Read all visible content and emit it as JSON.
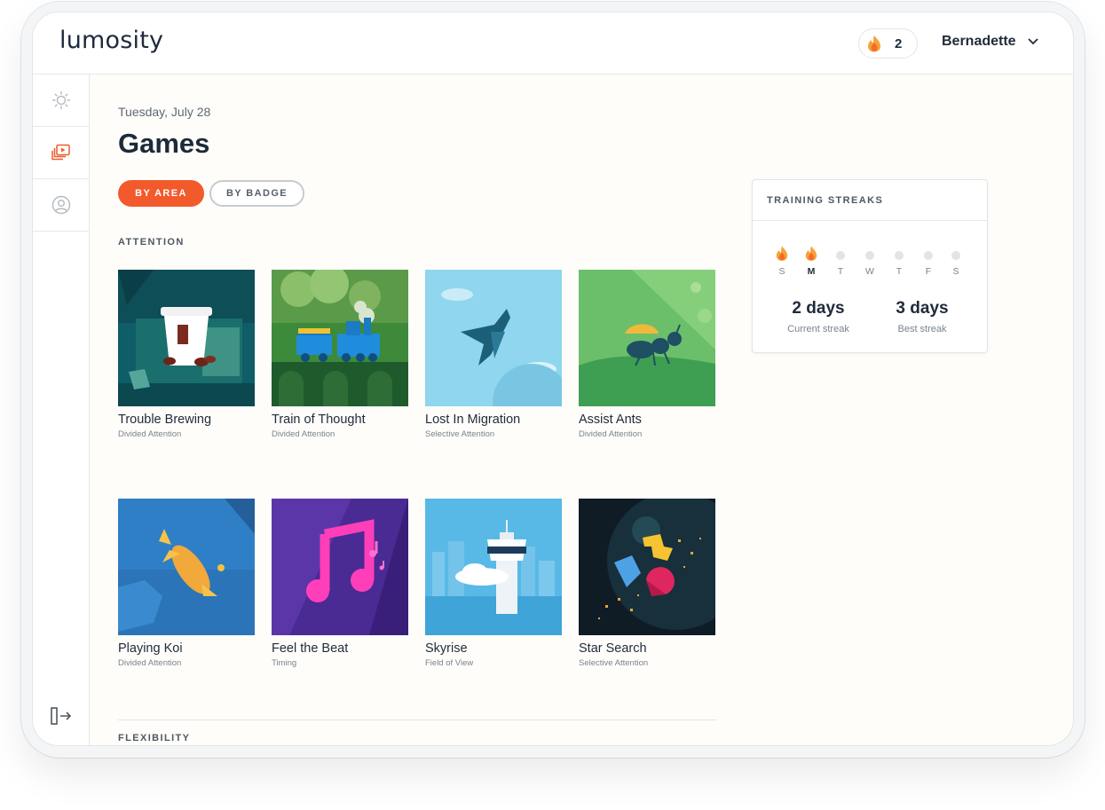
{
  "app": {
    "logo": "lumosity"
  },
  "header": {
    "streak_count": "2",
    "user_name": "Bernadette"
  },
  "sidebar": {
    "items": [
      {
        "icon": "sun-icon",
        "active": false
      },
      {
        "icon": "games-icon",
        "active": true
      },
      {
        "icon": "profile-icon",
        "active": false
      }
    ],
    "logout_icon": "logout-icon"
  },
  "page": {
    "date": "Tuesday, July 28",
    "title": "Games"
  },
  "filters": {
    "by_area": "BY AREA",
    "by_badge": "BY BADGE"
  },
  "sections": [
    {
      "label": "ATTENTION",
      "games": [
        {
          "name": "Trouble Brewing",
          "area": "Divided Attention"
        },
        {
          "name": "Train of Thought",
          "area": "Divided Attention"
        },
        {
          "name": "Lost In Migration",
          "area": "Selective Attention"
        },
        {
          "name": "Assist Ants",
          "area": "Divided Attention"
        },
        {
          "name": "Playing Koi",
          "area": "Divided Attention"
        },
        {
          "name": "Feel the Beat",
          "area": "Timing"
        },
        {
          "name": "Skyrise",
          "area": "Field of View"
        },
        {
          "name": "Star Search",
          "area": "Selective Attention"
        }
      ]
    },
    {
      "label": "FLEXIBILITY",
      "games": []
    }
  ],
  "streaks": {
    "title": "TRAINING STREAKS",
    "days": [
      {
        "letter": "S",
        "trained": true,
        "today": false
      },
      {
        "letter": "M",
        "trained": true,
        "today": true
      },
      {
        "letter": "T",
        "trained": false,
        "today": false
      },
      {
        "letter": "W",
        "trained": false,
        "today": false
      },
      {
        "letter": "T",
        "trained": false,
        "today": false
      },
      {
        "letter": "F",
        "trained": false,
        "today": false
      },
      {
        "letter": "S",
        "trained": false,
        "today": false
      }
    ],
    "current_value": "2 days",
    "current_label": "Current streak",
    "best_value": "3 days",
    "best_label": "Best streak"
  },
  "colors": {
    "accent": "#f25a2c",
    "text": "#1f2b3a",
    "flame": "#f7a13a"
  }
}
